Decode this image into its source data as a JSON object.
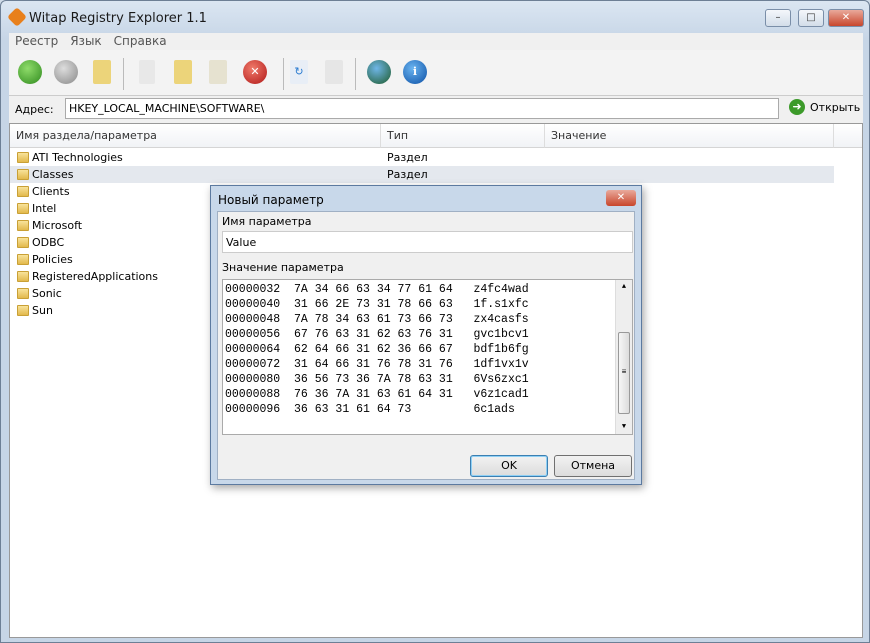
{
  "window": {
    "title": "Witap Registry Explorer 1.1",
    "min": "–",
    "max": "□",
    "close": "✕"
  },
  "menu": [
    "Реестр",
    "Язык",
    "Справка"
  ],
  "toolbar": [
    "back-icon",
    "forward-icon",
    "up-folder-icon",
    "new-key-icon",
    "new-folder-icon",
    "edit-icon",
    "delete-icon",
    "refresh-icon",
    "copy-icon",
    "globe-icon",
    "info-icon"
  ],
  "address": {
    "label": "Адрес:",
    "value": "HKEY_LOCAL_MACHINE\\SOFTWARE\\",
    "open": "Открыть"
  },
  "list": {
    "columns": [
      "Имя раздела/параметра",
      "Тип",
      "Значение"
    ],
    "rows": [
      {
        "name": "ATI Technologies",
        "type": "Раздел"
      },
      {
        "name": "Classes",
        "type": "Раздел"
      },
      {
        "name": "Clients",
        "type": ""
      },
      {
        "name": "Intel",
        "type": ""
      },
      {
        "name": "Microsoft",
        "type": ""
      },
      {
        "name": "ODBC",
        "type": ""
      },
      {
        "name": "Policies",
        "type": ""
      },
      {
        "name": "RegisteredApplications",
        "type": ""
      },
      {
        "name": "Sonic",
        "type": ""
      },
      {
        "name": "Sun",
        "type": ""
      }
    ]
  },
  "dialog": {
    "title": "Новый параметр",
    "close": "✕",
    "name_label": "Имя параметра",
    "name_value": "Value",
    "value_label": "Значение параметра",
    "hex": [
      "00000032  7A 34 66 63 34 77 61 64   z4fc4wad",
      "00000040  31 66 2E 73 31 78 66 63   1f.s1xfc",
      "00000048  7A 78 34 63 61 73 66 73   zx4casfs",
      "00000056  67 76 63 31 62 63 76 31   gvc1bcv1",
      "00000064  62 64 66 31 62 36 66 67   bdf1b6fg",
      "00000072  31 64 66 31 76 78 31 76   1df1vx1v",
      "00000080  36 56 73 36 7A 78 63 31   6Vs6zxc1",
      "00000088  76 36 7A 31 63 61 64 31   v6z1cad1",
      "00000096  36 63 31 61 64 73         6c1ads"
    ],
    "ok": "OK",
    "cancel": "Отмена"
  }
}
